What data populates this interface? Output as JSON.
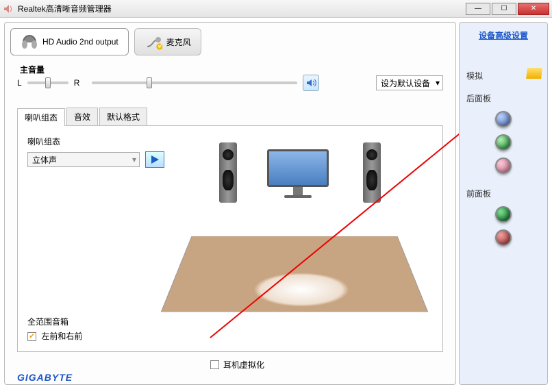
{
  "window": {
    "title": "Realtek高清晰音频管理器"
  },
  "toptabs": {
    "hd_audio": "HD Audio 2nd output",
    "mic": "麦克风"
  },
  "volume": {
    "title": "主音量",
    "left": "L",
    "right": "R",
    "default_device": "设为默认设备"
  },
  "subtabs": {
    "speaker_config": "喇叭组态",
    "sound_effect": "音效",
    "default_format": "默认格式"
  },
  "config": {
    "title": "喇叭组态",
    "mode": "立体声",
    "fullrange_title": "全范围音箱",
    "fullrange_opt": "左前和右前"
  },
  "virtualization": "耳机虚拟化",
  "side": {
    "advanced": "设备高级设置",
    "analog": "模拟",
    "rear": "后面板",
    "front": "前面板"
  },
  "brand": "GIGABYTE"
}
